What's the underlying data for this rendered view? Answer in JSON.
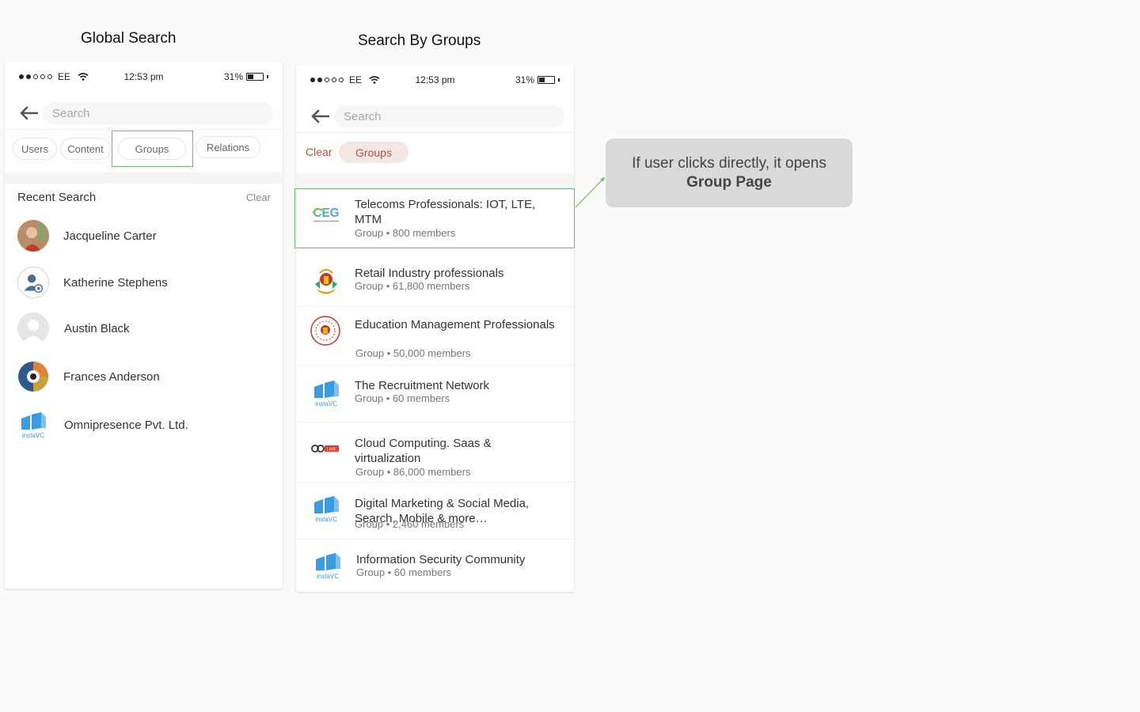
{
  "captions": {
    "left": "Global Search",
    "right": "Search By Groups"
  },
  "status": {
    "carrier": "EE",
    "time": "12:53 pm",
    "battery": "31%"
  },
  "global": {
    "search_placeholder": "Search",
    "tabs": [
      "Users",
      "Content",
      "Groups",
      "Relations"
    ],
    "recent_title": "Recent Search",
    "clear_label": "Clear",
    "recent": [
      "Jacqueline Carter",
      "Katherine Stephens",
      "Austin Black",
      "Frances Anderson",
      "Omnipresence Pvt. Ltd."
    ]
  },
  "groups_view": {
    "search_placeholder": "Search",
    "clear_label": "Clear",
    "active_filter": "Groups",
    "results": [
      {
        "name": "Telecoms Professionals: IOT, LTE, MTM",
        "meta": "Group • 800 members",
        "logo": "ceg-logo"
      },
      {
        "name": "Retail Industry professionals",
        "meta": "Group • 61,800 members",
        "logo": "emblem-logo"
      },
      {
        "name": "Education Management Professionals",
        "meta": "Group • 50,000 members",
        "logo": "seal-logo"
      },
      {
        "name": "The Recruitment Network",
        "meta": "Group • 60 members",
        "logo": "instavc-logo"
      },
      {
        "name": "Cloud Computing. Saas & virtualization",
        "meta": "Group • 86,000 members",
        "logo": "golive-logo"
      },
      {
        "name": "Digital Marketing & Social Media, Search, Mobile & more…",
        "meta": "Group • 2,460 members",
        "logo": "instavc-logo"
      },
      {
        "name": "Information Security Community",
        "meta": "Group • 60 members",
        "logo": "instavc-logo"
      }
    ]
  },
  "callout": {
    "line1": "If user clicks directly, it opens",
    "line2": "Group Page"
  },
  "logo_text": {
    "instavc": "instaVC",
    "ceg": "CEG",
    "golive": "LIVE"
  },
  "colors": {
    "accent_red": "#b5533f",
    "highlight_green": "#6cc26a",
    "chip_bg": "#f4e6e2"
  }
}
